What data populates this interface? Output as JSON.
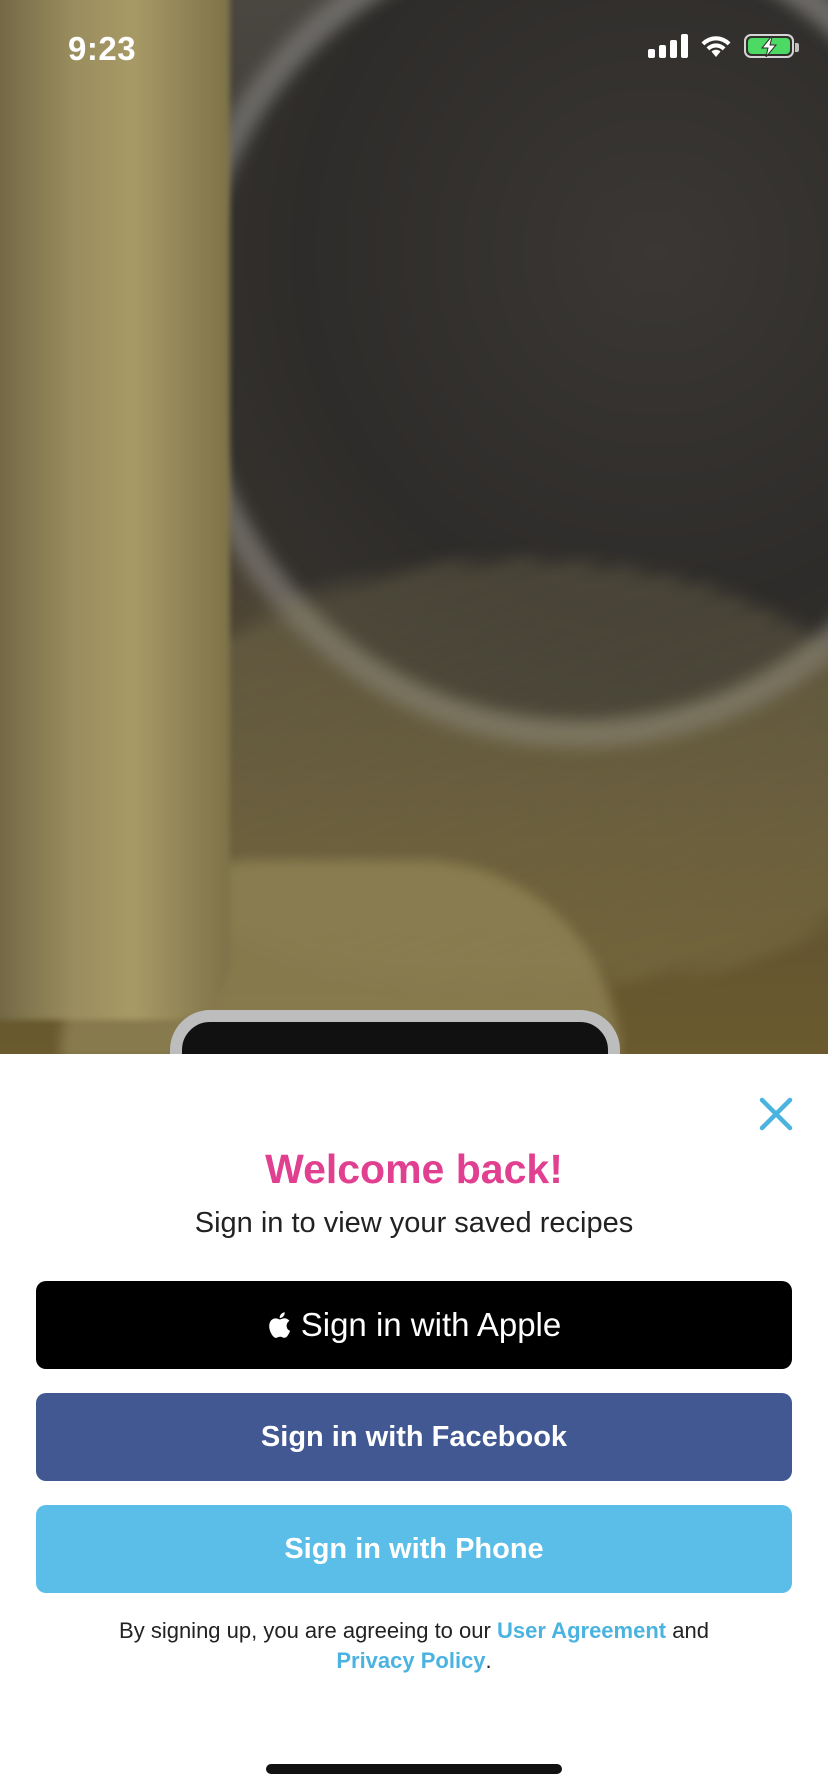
{
  "status_bar": {
    "time": "9:23"
  },
  "sheet": {
    "title": "Welcome back!",
    "subtitle": "Sign in to view your saved recipes",
    "buttons": {
      "apple_label": "Sign in with Apple",
      "facebook_label": "Sign in with Facebook",
      "phone_label": "Sign in with Phone"
    },
    "legal": {
      "prefix": "By signing up, you are agreeing to our",
      "user_agreement": "User Agreement",
      "conjunction": "and",
      "privacy_policy": "Privacy Policy",
      "suffix": "."
    }
  },
  "colors": {
    "title": "#e0408f",
    "apple": "#000000",
    "facebook": "#425893",
    "phone": "#5bbee8",
    "link": "#4bb3e0"
  },
  "icons": {
    "close": "close-icon",
    "apple": "apple-icon",
    "signal": "signal-icon",
    "wifi": "wifi-icon",
    "battery": "battery-charging-icon"
  }
}
